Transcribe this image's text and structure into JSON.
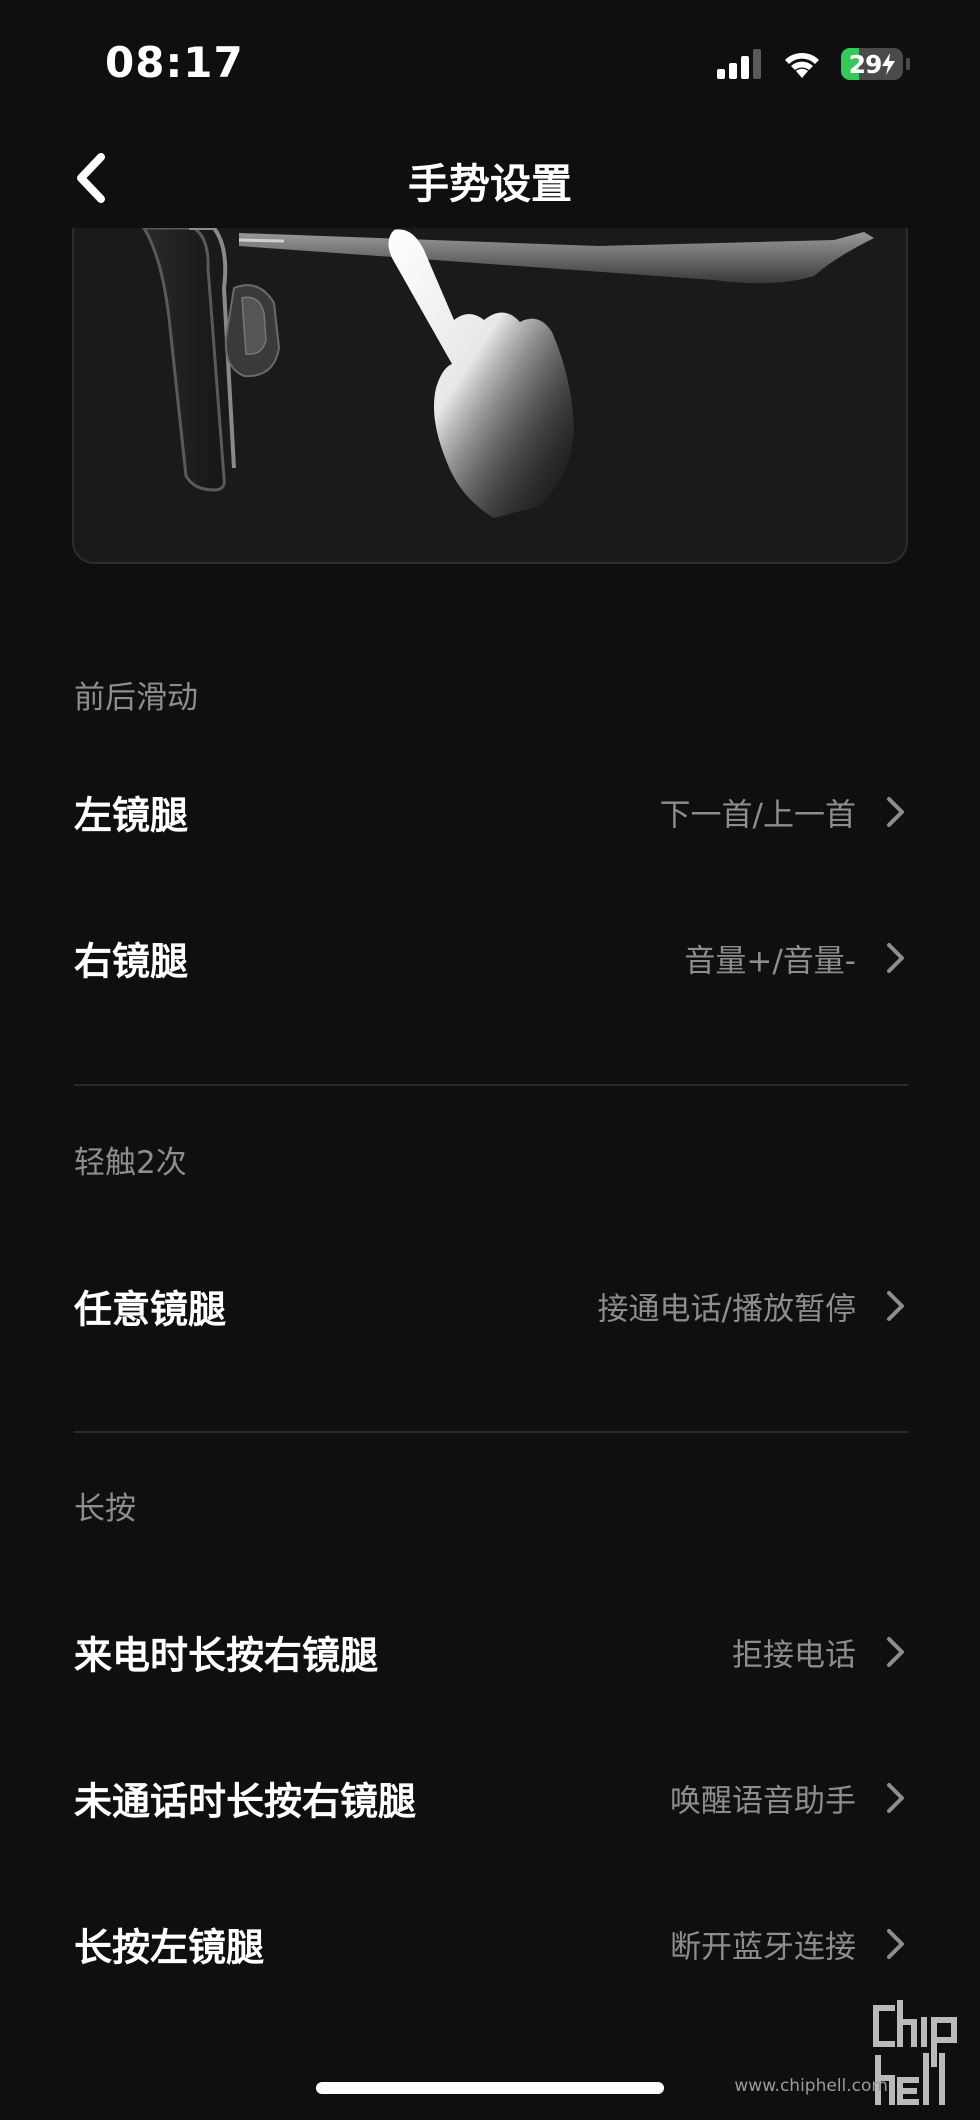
{
  "status_bar": {
    "time": "08:17",
    "battery_level": "29",
    "battery_fraction": 0.29,
    "icons": [
      "cellular-signal-icon",
      "wifi-icon",
      "battery-charging-icon"
    ]
  },
  "nav": {
    "title": "手势设置",
    "back_icon": "chevron-left-icon"
  },
  "illustration": {
    "icons": [
      "glasses-temple-icon",
      "finger-pointer-icon"
    ]
  },
  "sections": {
    "swipe": {
      "header": "前后滑动",
      "rows": [
        {
          "label": "左镜腿",
          "value": "下一首/上一首"
        },
        {
          "label": "右镜腿",
          "value": "音量+/音量-"
        }
      ]
    },
    "double_tap": {
      "header": "轻触2次",
      "rows": [
        {
          "label": "任意镜腿",
          "value": "接通电话/播放暂停"
        }
      ]
    },
    "long_press": {
      "header": "长按",
      "rows": [
        {
          "label": "来电时长按右镜腿",
          "value": "拒接电话"
        },
        {
          "label": "未通话时长按右镜腿",
          "value": "唤醒语音助手"
        },
        {
          "label": "长按左镜腿",
          "value": "断开蓝牙连接"
        }
      ]
    }
  },
  "watermark": {
    "brand": "chiphell",
    "url": "www.chiphell.com"
  },
  "colors": {
    "background": "#0f0f0f",
    "card": "#1a1a1a",
    "primary_text": "#ffffff",
    "secondary_text": "#8d8d8d",
    "divider": "#2a2a2a",
    "battery": "#34c759"
  }
}
